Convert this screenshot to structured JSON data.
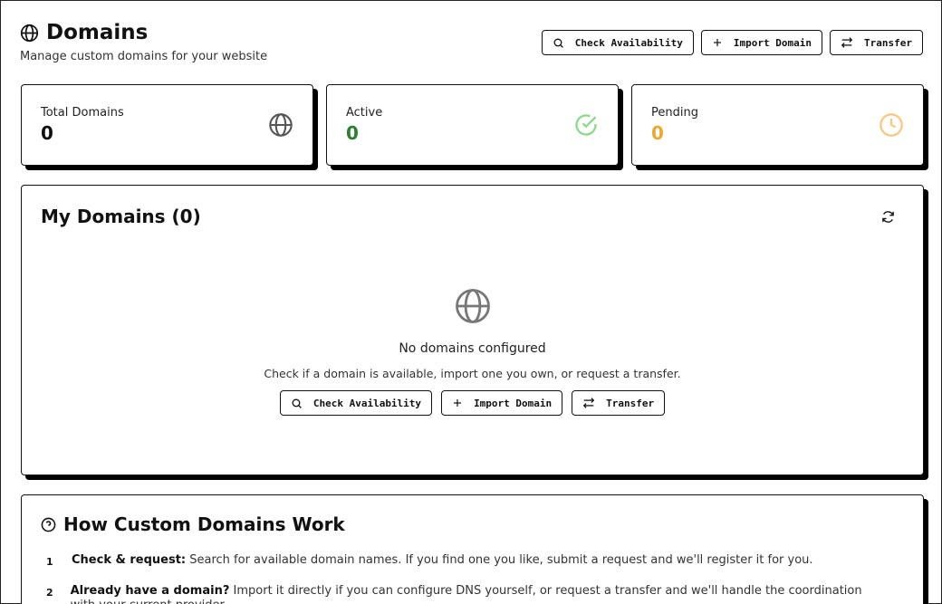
{
  "header": {
    "title": "Domains",
    "subtitle": "Manage custom domains for your website",
    "icon": "globe-icon",
    "actions": {
      "check_availability": "Check Availability",
      "import_domain": "Import Domain",
      "transfer": "Transfer"
    }
  },
  "stats": [
    {
      "label": "Total Domains",
      "value": "0",
      "icon": "globe-icon",
      "color": "#111111",
      "icon_color": "#555555"
    },
    {
      "label": "Active",
      "value": "0",
      "icon": "check-circle-icon",
      "color": "#2e7d32",
      "icon_color": "#8fd98f"
    },
    {
      "label": "Pending",
      "value": "0",
      "icon": "clock-icon",
      "color": "#e8a93a",
      "icon_color": "#f4c98a"
    }
  ],
  "my_domains": {
    "title": "My Domains (0)",
    "empty_title": "No domains configured",
    "empty_description": "Check if a domain is available, import one you own, or request a transfer.",
    "actions": {
      "check_availability": "Check Availability",
      "import_domain": "Import Domain",
      "transfer": "Transfer"
    }
  },
  "howto": {
    "title": "How Custom Domains Work",
    "steps": [
      {
        "num": "1",
        "bold": "Check & request:",
        "text": "Search for available domain names. If you find one you like, submit a request and we'll register it for you."
      },
      {
        "num": "2",
        "bold": "Already have a domain?",
        "text": "Import it directly if you can configure DNS yourself, or request a transfer and we'll handle the coordination with your current provider."
      }
    ]
  }
}
